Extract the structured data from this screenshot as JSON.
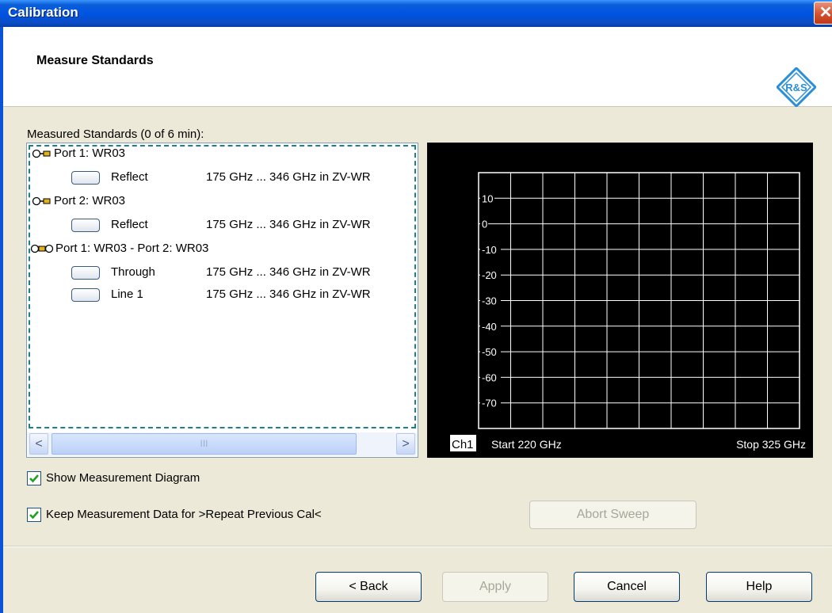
{
  "window": {
    "title": "Calibration",
    "close_symbol": "✕"
  },
  "header": {
    "title": "Measure Standards",
    "logo_text": "R&S"
  },
  "standards": {
    "label": "Measured Standards (0 of 6 min):",
    "groups": [
      {
        "port_label": "Port 1: WR03",
        "icon": "open-port-connector-icon",
        "items": [
          {
            "name": "Reflect",
            "range": "175 GHz ... 346 GHz  in ZV-WR"
          }
        ]
      },
      {
        "port_label": "Port 2: WR03",
        "icon": "open-port-connector-icon",
        "items": [
          {
            "name": "Reflect",
            "range": "175 GHz ... 346 GHz  in ZV-WR"
          }
        ]
      },
      {
        "port_label": "Port 1: WR03 - Port 2: WR03",
        "icon": "two-port-connector-icon",
        "items": [
          {
            "name": "Through",
            "range": "175 GHz ... 346 GHz  in ZV-WR"
          },
          {
            "name": "Line 1",
            "range": "175 GHz ... 346 GHz  in ZV-WR"
          }
        ]
      }
    ],
    "scroll_left": "<",
    "scroll_right": ">",
    "scroll_thumb_grip": "III"
  },
  "diagram": {
    "y_ticks": [
      "10",
      "0",
      "-10",
      "-20",
      "-30",
      "-40",
      "-50",
      "-60",
      "-70"
    ],
    "channel": "Ch1",
    "start": "Start 220 GHz",
    "stop": "Stop 325 GHz",
    "colors": {
      "background": "#000000",
      "grid": "#ffffff",
      "text": "#ffffff"
    }
  },
  "options": {
    "show_diagram": {
      "label": "Show Measurement Diagram",
      "checked": true
    },
    "keep_data": {
      "label": "Keep Measurement Data for >Repeat Previous Cal<",
      "checked": true
    }
  },
  "buttons": {
    "abort_sweep": "Abort Sweep",
    "back": "< Back",
    "apply": "Apply",
    "cancel": "Cancel",
    "help": "Help"
  }
}
